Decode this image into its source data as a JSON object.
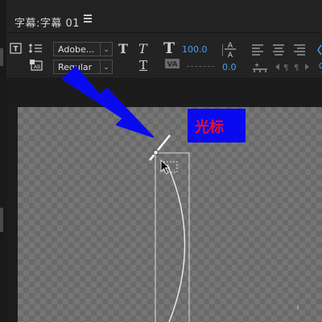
{
  "window": {
    "title": "字幕:字幕 01"
  },
  "toolbar": {
    "font_family": "Adobe...",
    "font_style": "Regular",
    "font_size": "100.0",
    "kerning": "0.0",
    "icon_letter_t": "T",
    "icon_size_t": "T"
  },
  "annotation": {
    "label": "光标"
  },
  "colors": {
    "arrow": "#0a0af0",
    "label_text": "#e8102a",
    "accent_number": "#4a9ff0"
  }
}
